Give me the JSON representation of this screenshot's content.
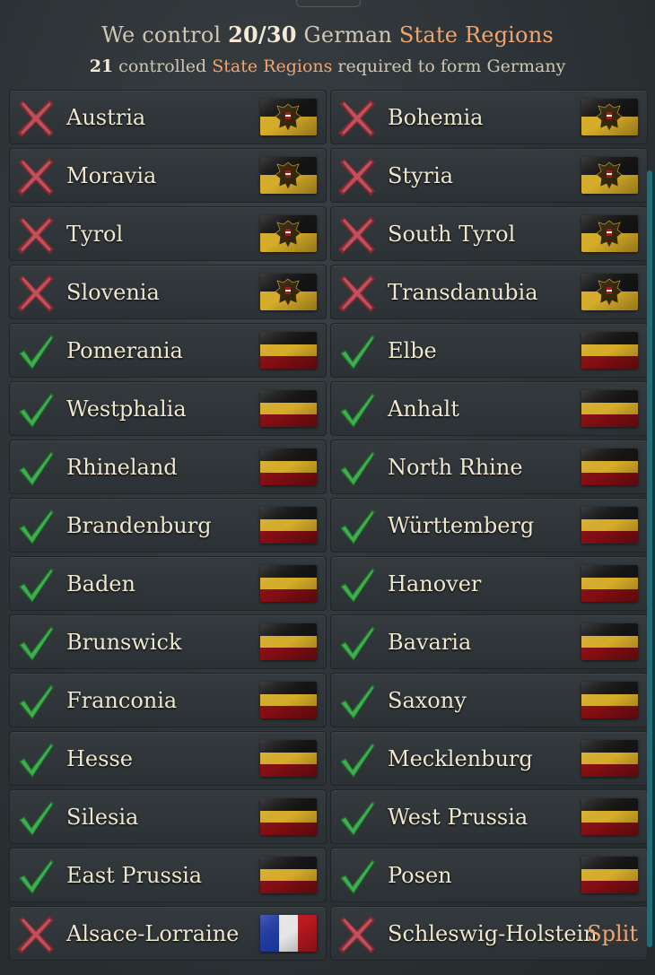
{
  "header": {
    "line1_pre": "We control ",
    "line1_count": "20/30",
    "line1_mid": " German ",
    "line1_link": "State Regions",
    "line2_count": "21",
    "line2_mid": " controlled ",
    "line2_link": "State Regions",
    "line2_post": " required to form Germany"
  },
  "regions": [
    {
      "name": "Austria",
      "status": "cross",
      "flag": "austria"
    },
    {
      "name": "Bohemia",
      "status": "cross",
      "flag": "austria"
    },
    {
      "name": "Moravia",
      "status": "cross",
      "flag": "austria"
    },
    {
      "name": "Styria",
      "status": "cross",
      "flag": "austria"
    },
    {
      "name": "Tyrol",
      "status": "cross",
      "flag": "austria"
    },
    {
      "name": "South Tyrol",
      "status": "cross",
      "flag": "austria"
    },
    {
      "name": "Slovenia",
      "status": "cross",
      "flag": "austria"
    },
    {
      "name": "Transdanubia",
      "status": "cross",
      "flag": "austria"
    },
    {
      "name": "Pomerania",
      "status": "check",
      "flag": "germany"
    },
    {
      "name": "Elbe",
      "status": "check",
      "flag": "germany"
    },
    {
      "name": "Westphalia",
      "status": "check",
      "flag": "germany"
    },
    {
      "name": "Anhalt",
      "status": "check",
      "flag": "germany"
    },
    {
      "name": "Rhineland",
      "status": "check",
      "flag": "germany"
    },
    {
      "name": "North Rhine",
      "status": "check",
      "flag": "germany"
    },
    {
      "name": "Brandenburg",
      "status": "check",
      "flag": "germany"
    },
    {
      "name": "Württemberg",
      "status": "check",
      "flag": "germany"
    },
    {
      "name": "Baden",
      "status": "check",
      "flag": "germany"
    },
    {
      "name": "Hanover",
      "status": "check",
      "flag": "germany"
    },
    {
      "name": "Brunswick",
      "status": "check",
      "flag": "germany"
    },
    {
      "name": "Bavaria",
      "status": "check",
      "flag": "germany"
    },
    {
      "name": "Franconia",
      "status": "check",
      "flag": "germany"
    },
    {
      "name": "Saxony",
      "status": "check",
      "flag": "germany"
    },
    {
      "name": "Hesse",
      "status": "check",
      "flag": "germany"
    },
    {
      "name": "Mecklenburg",
      "status": "check",
      "flag": "germany"
    },
    {
      "name": "Silesia",
      "status": "check",
      "flag": "germany"
    },
    {
      "name": "West Prussia",
      "status": "check",
      "flag": "germany"
    },
    {
      "name": "East Prussia",
      "status": "check",
      "flag": "germany"
    },
    {
      "name": "Posen",
      "status": "check",
      "flag": "germany"
    },
    {
      "name": "Alsace-Lorraine",
      "status": "cross",
      "flag": "france"
    },
    {
      "name": "Schleswig-Holstein",
      "status": "cross",
      "flag": "none",
      "label": "Split"
    }
  ],
  "colors": {
    "check": "#2a8a3a",
    "cross": "#b0404a",
    "accent": "#f2a46f"
  }
}
